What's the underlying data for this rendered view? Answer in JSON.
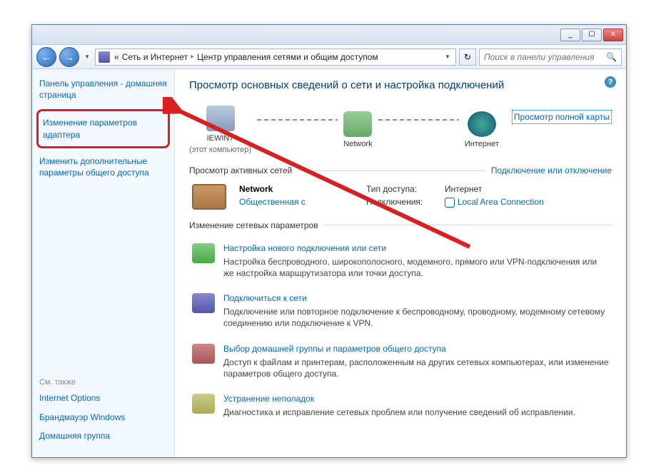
{
  "titlebar": {
    "min": "_",
    "max": "☐",
    "close": "✕"
  },
  "nav": {
    "back": "←",
    "fwd": "→",
    "dropdown": "▼",
    "dropdown2": "▼",
    "refresh": "↻"
  },
  "breadcrumb": {
    "prefix": "«",
    "item1": "Сеть и Интернет",
    "sep": "▸",
    "item2": "Центр управления сетями и общим доступом"
  },
  "search": {
    "placeholder": "Поиск в панели управления",
    "icon": "🔍"
  },
  "help": "?",
  "sidebar": {
    "home": "Панель управления - домашняя страница",
    "adapter": "Изменение параметров адаптера",
    "sharing": "Изменить дополнительные параметры общего доступа",
    "see_also": "См. также",
    "inet_options": "Internet Options",
    "firewall": "Брандмауэр Windows",
    "homegroup": "Домашняя группа"
  },
  "content": {
    "title": "Просмотр основных сведений о сети и настройка подключений",
    "diagram": {
      "pc": "IEWIN7",
      "pc_sub": "(этот компьютер)",
      "network": "Network",
      "internet": "Интернет",
      "map_link": "Просмотр полной карты"
    },
    "active_header": "Просмотр            активных сетей",
    "active_link": "Подключение или отключение",
    "network": {
      "name": "Network",
      "type": "Общественная с",
      "access_label": "Тип доступа:",
      "access_value": "Интернет",
      "conn_label": "Подключения:",
      "conn_value": "Local Area Connection"
    },
    "params_header": "Изменение сетевых параметров",
    "items": [
      {
        "link": "Настройка нового подключения или сети",
        "desc": "Настройка беспроводного, широкополосного, модемного, прямого или VPN-подключения или же настройка маршрутизатора или точки доступа."
      },
      {
        "link": "Подключиться к сети",
        "desc": "Подключение или повторное подключение к беспроводному, проводному, модемному сетевому соединению или подключение к VPN."
      },
      {
        "link": "Выбор домашней группы и параметров общего доступа",
        "desc": "Доступ к файлам и принтерам, расположенным на других сетевых компьютерах, или изменение параметров общего доступа."
      },
      {
        "link": "Устранение неполадок",
        "desc": "Диагностика и исправление сетевых проблем или получение сведений об исправлении."
      }
    ]
  }
}
